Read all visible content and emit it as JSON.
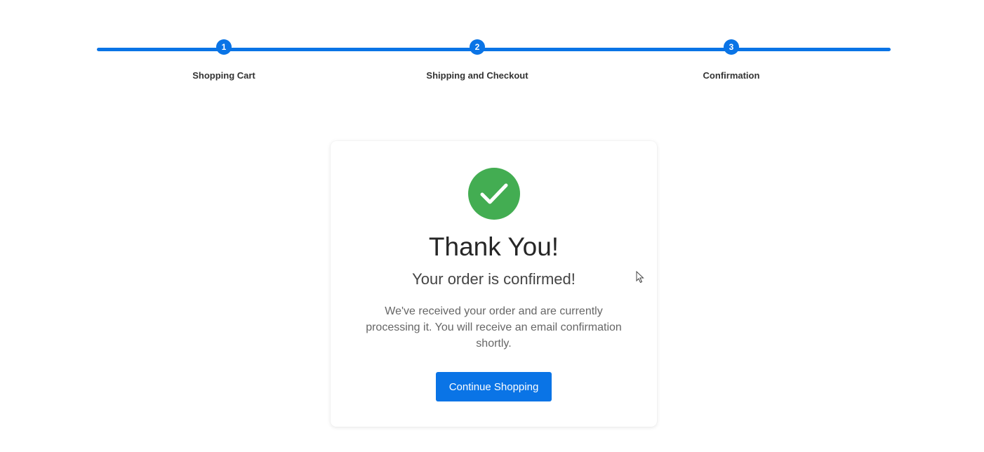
{
  "stepper": {
    "steps": [
      {
        "number": "1",
        "label": "Shopping Cart"
      },
      {
        "number": "2",
        "label": "Shipping and Checkout"
      },
      {
        "number": "3",
        "label": "Confirmation"
      }
    ],
    "accent_color": "#0a74e6"
  },
  "confirmation": {
    "icon": "checkmark-icon",
    "icon_color": "#43ad52",
    "title": "Thank You!",
    "subtitle": "Your order is confirmed!",
    "message": "We've received your order and are currently processing it. You will receive an email confirmation shortly.",
    "button_label": "Continue Shopping"
  }
}
